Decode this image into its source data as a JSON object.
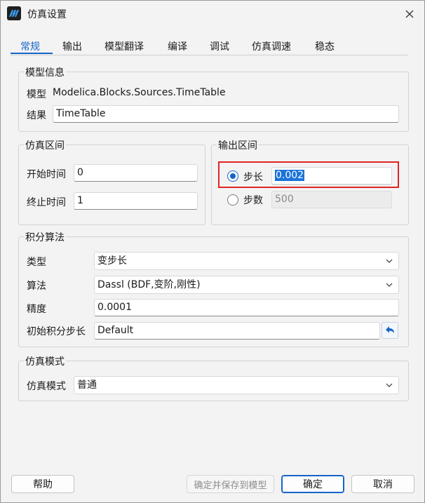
{
  "window": {
    "title": "仿真设置"
  },
  "tabs": [
    {
      "label": "常规",
      "active": true
    },
    {
      "label": "输出"
    },
    {
      "label": "模型翻译"
    },
    {
      "label": "编译"
    },
    {
      "label": "调试"
    },
    {
      "label": "仿真调速"
    },
    {
      "label": "稳态"
    }
  ],
  "model_info": {
    "title": "模型信息",
    "model_label": "模型",
    "model_value": "Modelica.Blocks.Sources.TimeTable",
    "result_label": "结果",
    "result_value": "TimeTable"
  },
  "sim_interval": {
    "title": "仿真区间",
    "start_label": "开始时间",
    "start_value": "0",
    "stop_label": "终止时间",
    "stop_value": "1"
  },
  "output_interval": {
    "title": "输出区间",
    "step_label": "步长",
    "step_value": "0.002",
    "count_label": "步数",
    "count_value": "500",
    "selected": "step"
  },
  "integration": {
    "title": "积分算法",
    "type_label": "类型",
    "type_value": "变步长",
    "algo_label": "算法",
    "algo_value": "Dassl (BDF,变阶,刚性)",
    "precision_label": "精度",
    "precision_value": "0.0001",
    "init_step_label": "初始积分步长",
    "init_step_value": "Default"
  },
  "sim_mode": {
    "title": "仿真模式",
    "mode_label": "仿真模式",
    "mode_value": "普通"
  },
  "footer": {
    "help": "帮助",
    "confirm_save": "确定并保存到模型",
    "ok": "确定",
    "cancel": "取消"
  },
  "colors": {
    "accent": "#1464c8",
    "highlight": "#e02424"
  }
}
